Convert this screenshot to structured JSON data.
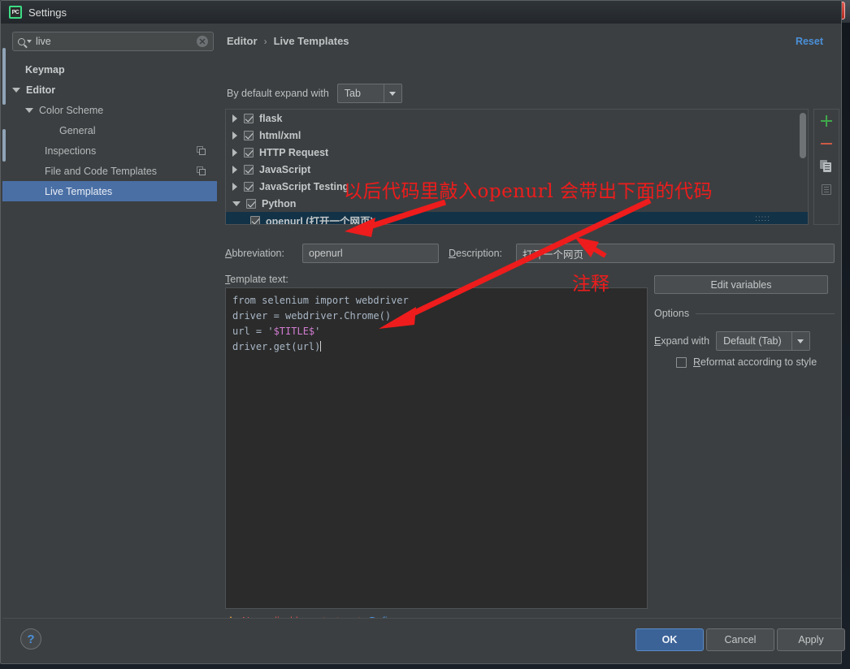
{
  "background": {
    "close_button_label": "x"
  },
  "dialog": {
    "title": "Settings",
    "logo_text": "PC"
  },
  "search": {
    "value": "live",
    "placeholder": "",
    "clear_label": "✕",
    "icon": "search-icon"
  },
  "sidebar": {
    "items": [
      {
        "label": "Keymap",
        "indent": 1,
        "expander": "none",
        "bold": true,
        "selected": false,
        "icon": ""
      },
      {
        "label": "Editor",
        "indent": 0,
        "expander": "down",
        "bold": true,
        "selected": false,
        "icon": ""
      },
      {
        "label": "Color Scheme",
        "indent": 1,
        "expander": "down",
        "bold": false,
        "selected": false,
        "icon": ""
      },
      {
        "label": "General",
        "indent": 3,
        "expander": "none",
        "bold": false,
        "selected": false,
        "icon": ""
      },
      {
        "label": "Inspections",
        "indent": 2,
        "expander": "none",
        "bold": false,
        "selected": false,
        "icon": "copy-icon"
      },
      {
        "label": "File and Code Templates",
        "indent": 2,
        "expander": "none",
        "bold": false,
        "selected": false,
        "icon": "copy-icon"
      },
      {
        "label": "Live Templates",
        "indent": 2,
        "expander": "none",
        "bold": false,
        "selected": true,
        "icon": ""
      }
    ]
  },
  "main": {
    "breadcrumb": {
      "parent": "Editor",
      "separator": "›",
      "current": "Live Templates"
    },
    "reset_label": "Reset",
    "expand_with": {
      "label": "By default expand with",
      "value": "Tab"
    },
    "templates": [
      {
        "label": "flask",
        "expander": "right",
        "checked": true,
        "child": false,
        "selected": false
      },
      {
        "label": "html/xml",
        "expander": "right",
        "checked": true,
        "child": false,
        "selected": false
      },
      {
        "label": "HTTP Request",
        "expander": "right",
        "checked": true,
        "child": false,
        "selected": false
      },
      {
        "label": "JavaScript",
        "expander": "right",
        "checked": true,
        "child": false,
        "selected": false
      },
      {
        "label": "JavaScript Testing",
        "expander": "right",
        "checked": true,
        "child": false,
        "selected": false
      },
      {
        "label": "Python",
        "expander": "down",
        "checked": true,
        "child": false,
        "selected": false
      },
      {
        "label": "openurl (打开一个网页)",
        "expander": "none",
        "checked": true,
        "child": true,
        "selected": true
      }
    ],
    "toolbar": {
      "add": "+",
      "remove": "−",
      "duplicate": "duplicate-icon",
      "copy_group": "document-icon"
    },
    "abbreviation": {
      "label": "Abbreviation:",
      "value": "openurl"
    },
    "description": {
      "label": "Description:",
      "value": "打开一个网页"
    },
    "template_text_label": "Template text:",
    "code": {
      "lines": [
        {
          "pre": "from selenium import webdriver",
          "var": "",
          "post": ""
        },
        {
          "pre": "driver = webdriver.Chrome()",
          "var": "",
          "post": ""
        },
        {
          "pre": "url = '",
          "var": "$TITLE$",
          "post": "'"
        },
        {
          "pre": "driver.get(url)",
          "var": "",
          "post": ""
        }
      ],
      "variable_color": "#d17cd1"
    },
    "edit_variables_label": "Edit variables",
    "options": {
      "title": "Options",
      "expand_with_label": "Expand with",
      "expand_with_value": "Default (Tab)",
      "reformat_label": "Reformat according to style",
      "reformat_checked": false
    },
    "warning": {
      "text": "No applicable contexts yet.",
      "link": "Define"
    }
  },
  "footer": {
    "help_label": "?",
    "ok_label": "OK",
    "cancel_label": "Cancel",
    "apply_label": "Apply"
  },
  "annotations": {
    "note_top": "以后代码里敲入openurl 会带出下面的代码",
    "note_desc": "注释",
    "color": "#ee1c1c"
  }
}
